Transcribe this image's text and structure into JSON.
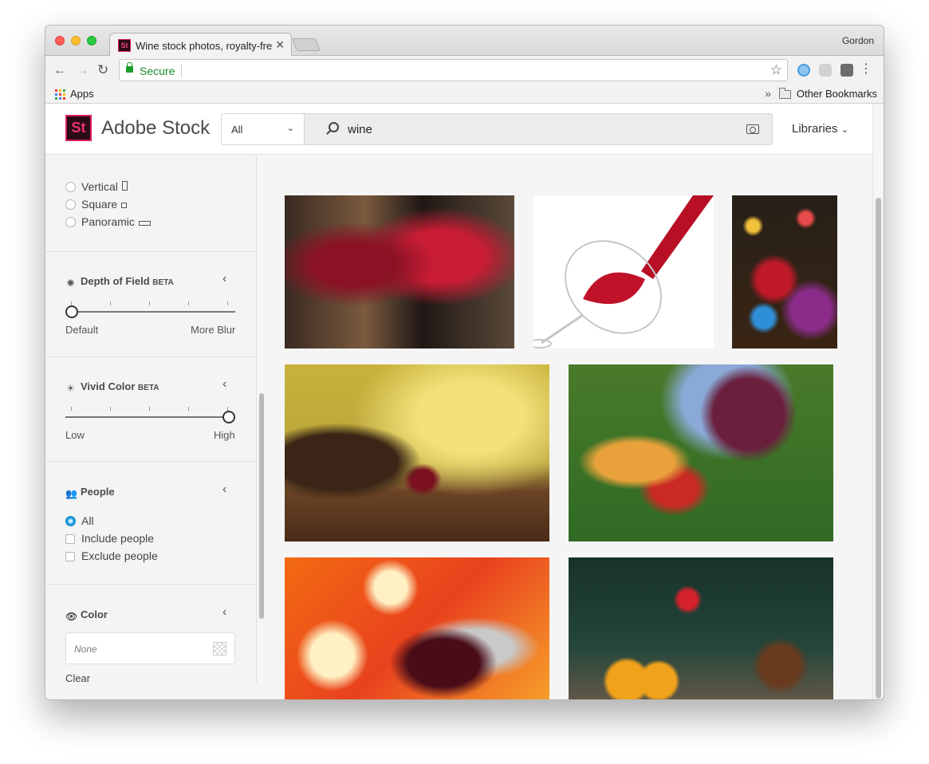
{
  "browser": {
    "tab_title": "Wine stock photos, royalty-free",
    "favicon_text": "St",
    "profile_name": "Gordon",
    "secure_label": "Secure",
    "bookmarks": {
      "apps_label": "Apps",
      "more": "»",
      "other_bookmarks": "Other Bookmarks"
    }
  },
  "header": {
    "logo_box": "St",
    "logo_text": "Adobe Stock",
    "scope_value": "All",
    "search_query": "wine",
    "libraries_label": "Libraries"
  },
  "sidebar": {
    "orientation": [
      {
        "label": "Vertical"
      },
      {
        "label": "Square"
      },
      {
        "label": "Panoramic"
      }
    ],
    "depth_of_field": {
      "title": "Depth of Field",
      "beta": "BETA",
      "min_label": "Default",
      "max_label": "More Blur",
      "value": 0
    },
    "vivid_color": {
      "title": "Vivid Color",
      "beta": "BETA",
      "min_label": "Low",
      "max_label": "High",
      "value": 1
    },
    "people": {
      "title": "People",
      "options": [
        {
          "label": "All",
          "selected": true
        },
        {
          "label": "Include people",
          "selected": false
        },
        {
          "label": "Exclude people",
          "selected": false
        }
      ]
    },
    "color": {
      "title": "Color",
      "placeholder": "None",
      "clear_label": "Clear"
    }
  },
  "colors": {
    "accent": "#da1f5d",
    "selected_radio": "#1a8fd6",
    "secure_green": "#1a8a2b"
  }
}
